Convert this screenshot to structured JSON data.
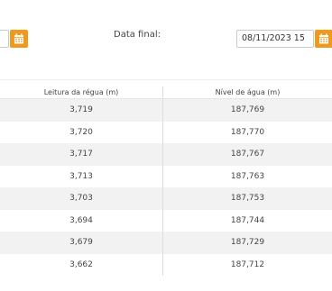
{
  "filters": {
    "end_label": "Data final:",
    "end_value": "08/11/2023 15"
  },
  "table": {
    "headers": [
      "Leitura da régua (m)",
      "Nível de água (m)"
    ],
    "rows": [
      [
        "3,719",
        "187,769"
      ],
      [
        "3,720",
        "187,770"
      ],
      [
        "3,717",
        "187,767"
      ],
      [
        "3,713",
        "187,763"
      ],
      [
        "3,703",
        "187,753"
      ],
      [
        "3,694",
        "187,744"
      ],
      [
        "3,679",
        "187,729"
      ],
      [
        "3,662",
        "187,712"
      ]
    ]
  },
  "colors": {
    "accent": "#ee9a1c",
    "row_stripe": "#f2f2f2"
  },
  "icons": {
    "calendar": "calendar-icon"
  }
}
